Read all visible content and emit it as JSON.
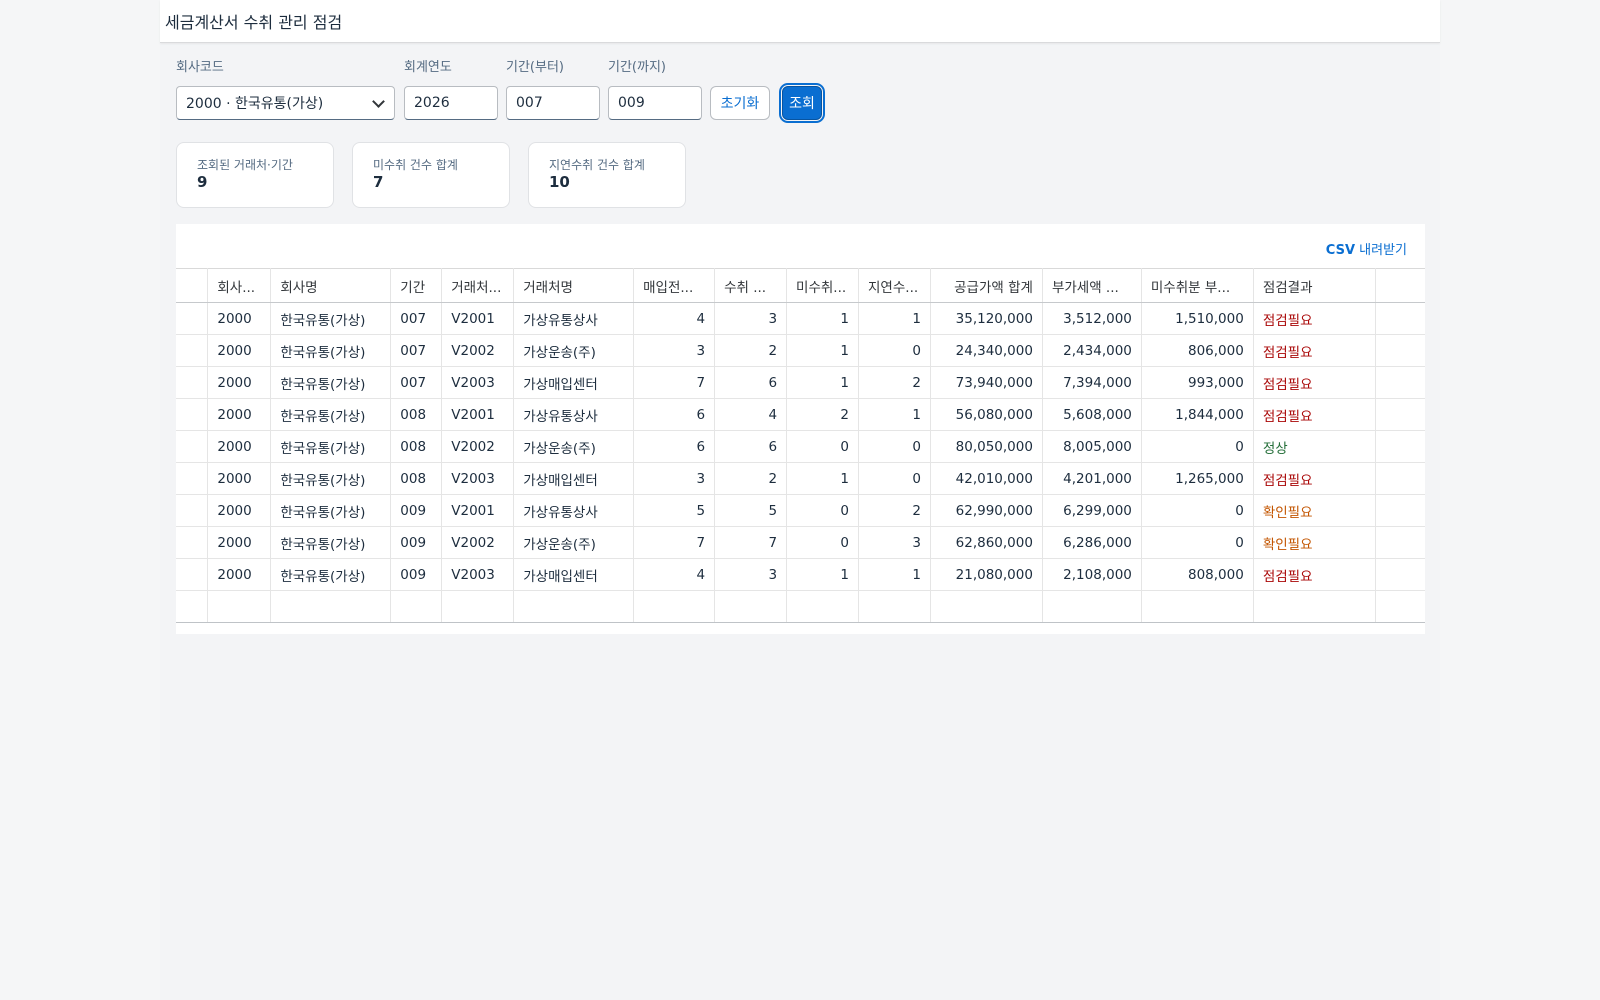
{
  "title": "세금계산서 수취 관리 점검",
  "filters": {
    "company_label": "회사코드",
    "company_value": "2000 · 한국유통(가상)",
    "year_label": "회계연도",
    "year_value": "2026",
    "from_label": "기간(부터)",
    "from_value": "007",
    "to_label": "기간(까지)",
    "to_value": "009",
    "reset_label": "초기화",
    "search_label": "조회"
  },
  "summary": [
    {
      "label": "조회된 거래처·기간",
      "value": "9"
    },
    {
      "label": "미수취 건수 합계",
      "value": "7"
    },
    {
      "label": "지연수취 건수 합계",
      "value": "10"
    }
  ],
  "csv": {
    "prefix": "CSV",
    "label": "내려받기"
  },
  "columns": [
    "회사...",
    "회사명",
    "기간",
    "거래처...",
    "거래처명",
    "매입전...",
    "수취 ...",
    "미수취...",
    "지연수...",
    "공급가액 합계",
    "부가세액 ...",
    "미수취분 부...",
    "점검결과"
  ],
  "rows": [
    {
      "code": "2000",
      "company": "한국유통(가상)",
      "period": "007",
      "vendor": "V2001",
      "vendor_name": "가상유통상사",
      "purchase": "4",
      "received": "3",
      "missing": "1",
      "late": "1",
      "supply": "35,120,000",
      "vat": "3,512,000",
      "missing_vat": "1,510,000",
      "result": "점검필요",
      "status": "warn"
    },
    {
      "code": "2000",
      "company": "한국유통(가상)",
      "period": "007",
      "vendor": "V2002",
      "vendor_name": "가상운송(주)",
      "purchase": "3",
      "received": "2",
      "missing": "1",
      "late": "0",
      "supply": "24,340,000",
      "vat": "2,434,000",
      "missing_vat": "806,000",
      "result": "점검필요",
      "status": "warn"
    },
    {
      "code": "2000",
      "company": "한국유통(가상)",
      "period": "007",
      "vendor": "V2003",
      "vendor_name": "가상매입센터",
      "purchase": "7",
      "received": "6",
      "missing": "1",
      "late": "2",
      "supply": "73,940,000",
      "vat": "7,394,000",
      "missing_vat": "993,000",
      "result": "점검필요",
      "status": "warn"
    },
    {
      "code": "2000",
      "company": "한국유통(가상)",
      "period": "008",
      "vendor": "V2001",
      "vendor_name": "가상유통상사",
      "purchase": "6",
      "received": "4",
      "missing": "2",
      "late": "1",
      "supply": "56,080,000",
      "vat": "5,608,000",
      "missing_vat": "1,844,000",
      "result": "점검필요",
      "status": "warn"
    },
    {
      "code": "2000",
      "company": "한국유통(가상)",
      "period": "008",
      "vendor": "V2002",
      "vendor_name": "가상운송(주)",
      "purchase": "6",
      "received": "6",
      "missing": "0",
      "late": "0",
      "supply": "80,050,000",
      "vat": "8,005,000",
      "missing_vat": "0",
      "result": "정상",
      "status": "ok"
    },
    {
      "code": "2000",
      "company": "한국유통(가상)",
      "period": "008",
      "vendor": "V2003",
      "vendor_name": "가상매입센터",
      "purchase": "3",
      "received": "2",
      "missing": "1",
      "late": "0",
      "supply": "42,010,000",
      "vat": "4,201,000",
      "missing_vat": "1,265,000",
      "result": "점검필요",
      "status": "warn"
    },
    {
      "code": "2000",
      "company": "한국유통(가상)",
      "period": "009",
      "vendor": "V2001",
      "vendor_name": "가상유통상사",
      "purchase": "5",
      "received": "5",
      "missing": "0",
      "late": "2",
      "supply": "62,990,000",
      "vat": "6,299,000",
      "missing_vat": "0",
      "result": "확인필요",
      "status": "check"
    },
    {
      "code": "2000",
      "company": "한국유통(가상)",
      "period": "009",
      "vendor": "V2002",
      "vendor_name": "가상운송(주)",
      "purchase": "7",
      "received": "7",
      "missing": "0",
      "late": "3",
      "supply": "62,860,000",
      "vat": "6,286,000",
      "missing_vat": "0",
      "result": "확인필요",
      "status": "check"
    },
    {
      "code": "2000",
      "company": "한국유통(가상)",
      "period": "009",
      "vendor": "V2003",
      "vendor_name": "가상매입센터",
      "purchase": "4",
      "received": "3",
      "missing": "1",
      "late": "1",
      "supply": "21,080,000",
      "vat": "2,108,000",
      "missing_vat": "808,000",
      "result": "점검필요",
      "status": "warn"
    }
  ],
  "status_colors": {
    "warn": "#aa0808",
    "ok": "#256f3a",
    "check": "#c35500"
  }
}
